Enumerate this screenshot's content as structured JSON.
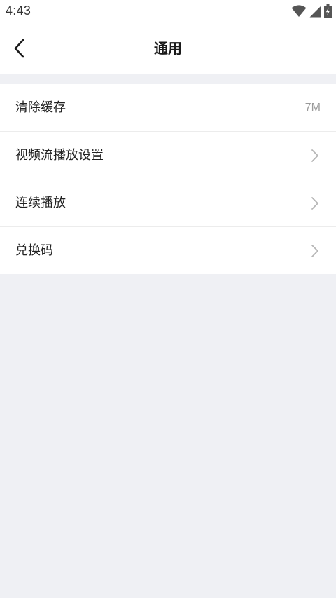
{
  "status_bar": {
    "time": "4:43",
    "icons": [
      "wifi-icon",
      "cellular-signal-icon",
      "battery-charging-icon"
    ]
  },
  "header": {
    "title": "通用",
    "back_icon": "chevron-left-icon"
  },
  "settings": {
    "items": [
      {
        "label": "清除缓存",
        "value": "7M"
      },
      {
        "label": "视频流播放设置",
        "icon": "chevron-right-icon"
      },
      {
        "label": "连续播放",
        "icon": "chevron-right-icon"
      },
      {
        "label": "兑换码",
        "icon": "chevron-right-icon"
      }
    ]
  },
  "colors": {
    "background": "#eff0f4",
    "surface": "#ffffff",
    "text_primary": "#222222",
    "text_secondary": "#999999",
    "divider": "#ececec"
  }
}
